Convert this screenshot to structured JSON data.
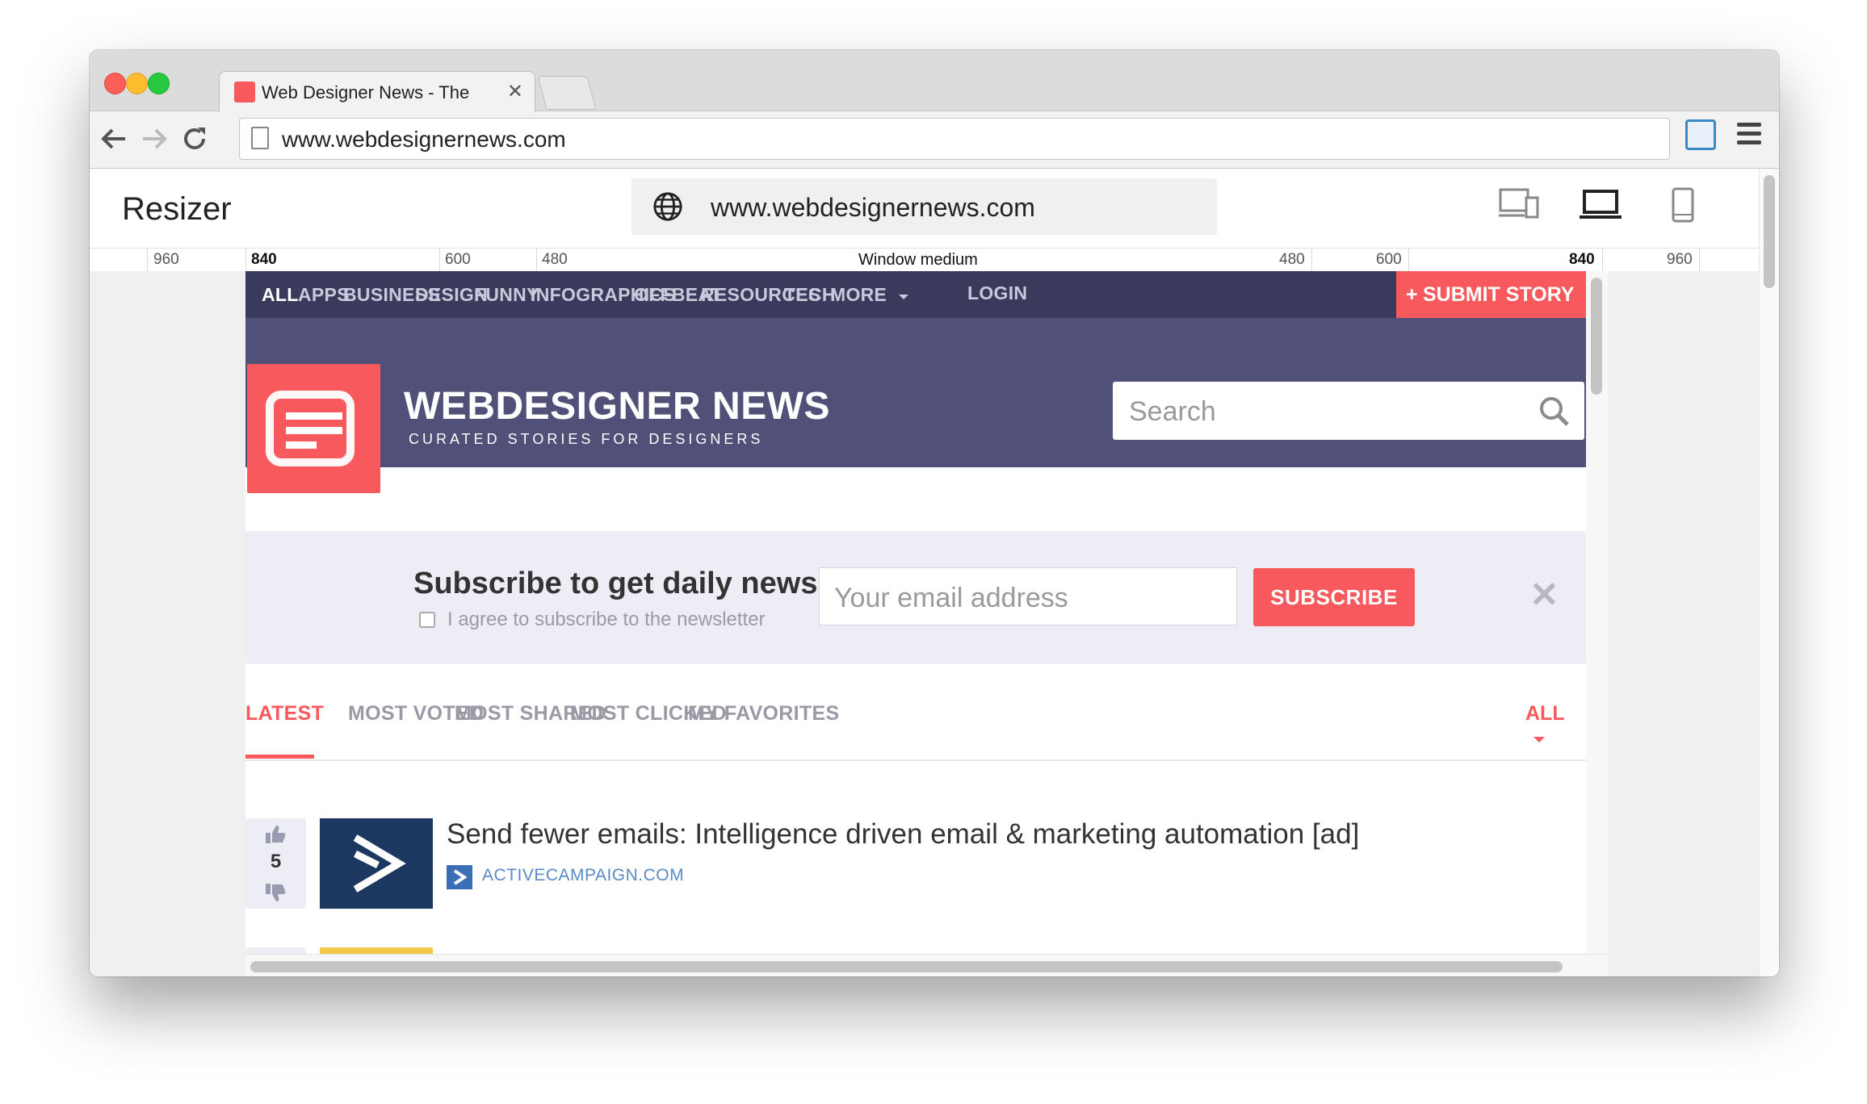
{
  "browser": {
    "tab_title": "Web Designer News - The",
    "tab_close": "✕",
    "url": "www.webdesignernews.com"
  },
  "resizer": {
    "title": "Resizer",
    "url": "www.webdesignernews.com",
    "devices": [
      "multi-device-icon",
      "laptop-icon",
      "phone-icon"
    ],
    "ruler": {
      "label": "Window medium",
      "marks_left": [
        "960",
        "840",
        "600",
        "480"
      ],
      "marks_right": [
        "480",
        "600",
        "840",
        "960"
      ]
    }
  },
  "site": {
    "nav": [
      "ALL",
      "APPS",
      "BUSINESS",
      "DESIGN",
      "FUNNY",
      "INFOGRAPHICS",
      "OFFBEAT",
      "RESOURCES",
      "TECH",
      "MORE"
    ],
    "login": "LOGIN",
    "submit": "SUBMIT STORY",
    "submit_plus": "+",
    "brand": "WEBDESIGNER NEWS",
    "tagline": "CURATED STORIES FOR DESIGNERS",
    "search_placeholder": "Search",
    "subscribe": {
      "title": "Subscribe to get daily news",
      "agree": "I agree to subscribe to the newsletter",
      "email_placeholder": "Your email address",
      "button": "SUBSCRIBE",
      "close": "✕"
    },
    "filters": [
      "LATEST",
      "MOST VOTED",
      "MOST SHARED",
      "MOST CLICKED",
      "MY FAVORITES"
    ],
    "filter_all": "ALL",
    "stories": [
      {
        "votes": "5",
        "title": "Send fewer emails: Intelligence driven email & marketing automation [ad]",
        "source": "ACTIVECAMPAIGN.COM"
      }
    ]
  },
  "colors": {
    "accent": "#f7595c",
    "nav_bg": "#3a3a5c",
    "header_bg": "#505078",
    "subscribe_bg": "#ecedf5"
  }
}
